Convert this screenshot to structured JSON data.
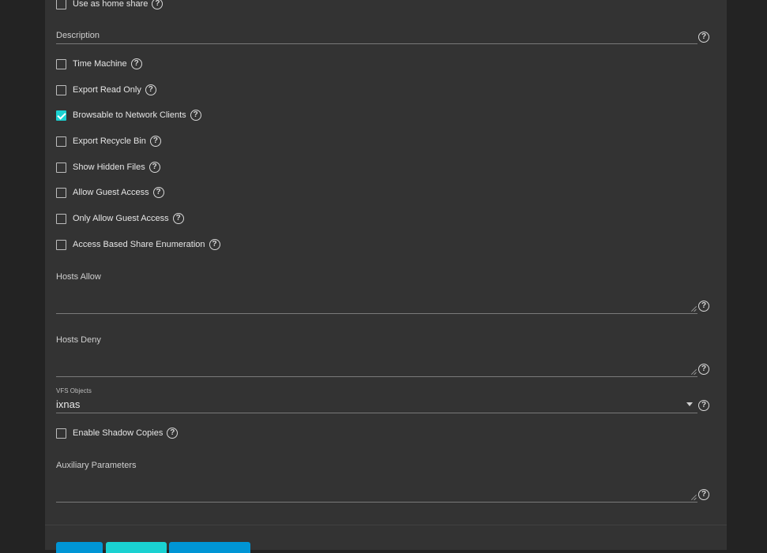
{
  "form": {
    "checkboxes": [
      {
        "label": "Use as home share",
        "checked": false
      },
      {
        "label": "Time Machine",
        "checked": false
      },
      {
        "label": "Export Read Only",
        "checked": false
      },
      {
        "label": "Browsable to Network Clients",
        "checked": true
      },
      {
        "label": "Export Recycle Bin",
        "checked": false
      },
      {
        "label": "Show Hidden Files",
        "checked": false
      },
      {
        "label": "Allow Guest Access",
        "checked": false
      },
      {
        "label": "Only Allow Guest Access",
        "checked": false
      },
      {
        "label": "Access Based Share Enumeration",
        "checked": false
      }
    ],
    "description": {
      "label": "Description",
      "value": ""
    },
    "hosts_allow": {
      "label": "Hosts Allow",
      "value": ""
    },
    "hosts_deny": {
      "label": "Hosts Deny",
      "value": ""
    },
    "vfs_objects": {
      "label": "VFS Objects",
      "value": "ixnas"
    },
    "shadow_copies": {
      "label": "Enable Shadow Copies",
      "checked": false
    },
    "aux_params": {
      "label": "Auxiliary Parameters",
      "value": ""
    },
    "help_glyph": "?"
  },
  "colors": {
    "page_bg": "#232323",
    "panel_bg": "#333333",
    "accent_checked": "#1ad1d1",
    "button_primary": "#0095d5",
    "button_secondary": "#1ad1d1"
  },
  "icons": {
    "help": "question-circle-icon",
    "dropdown": "caret-down-icon",
    "check": "checkmark-icon"
  }
}
